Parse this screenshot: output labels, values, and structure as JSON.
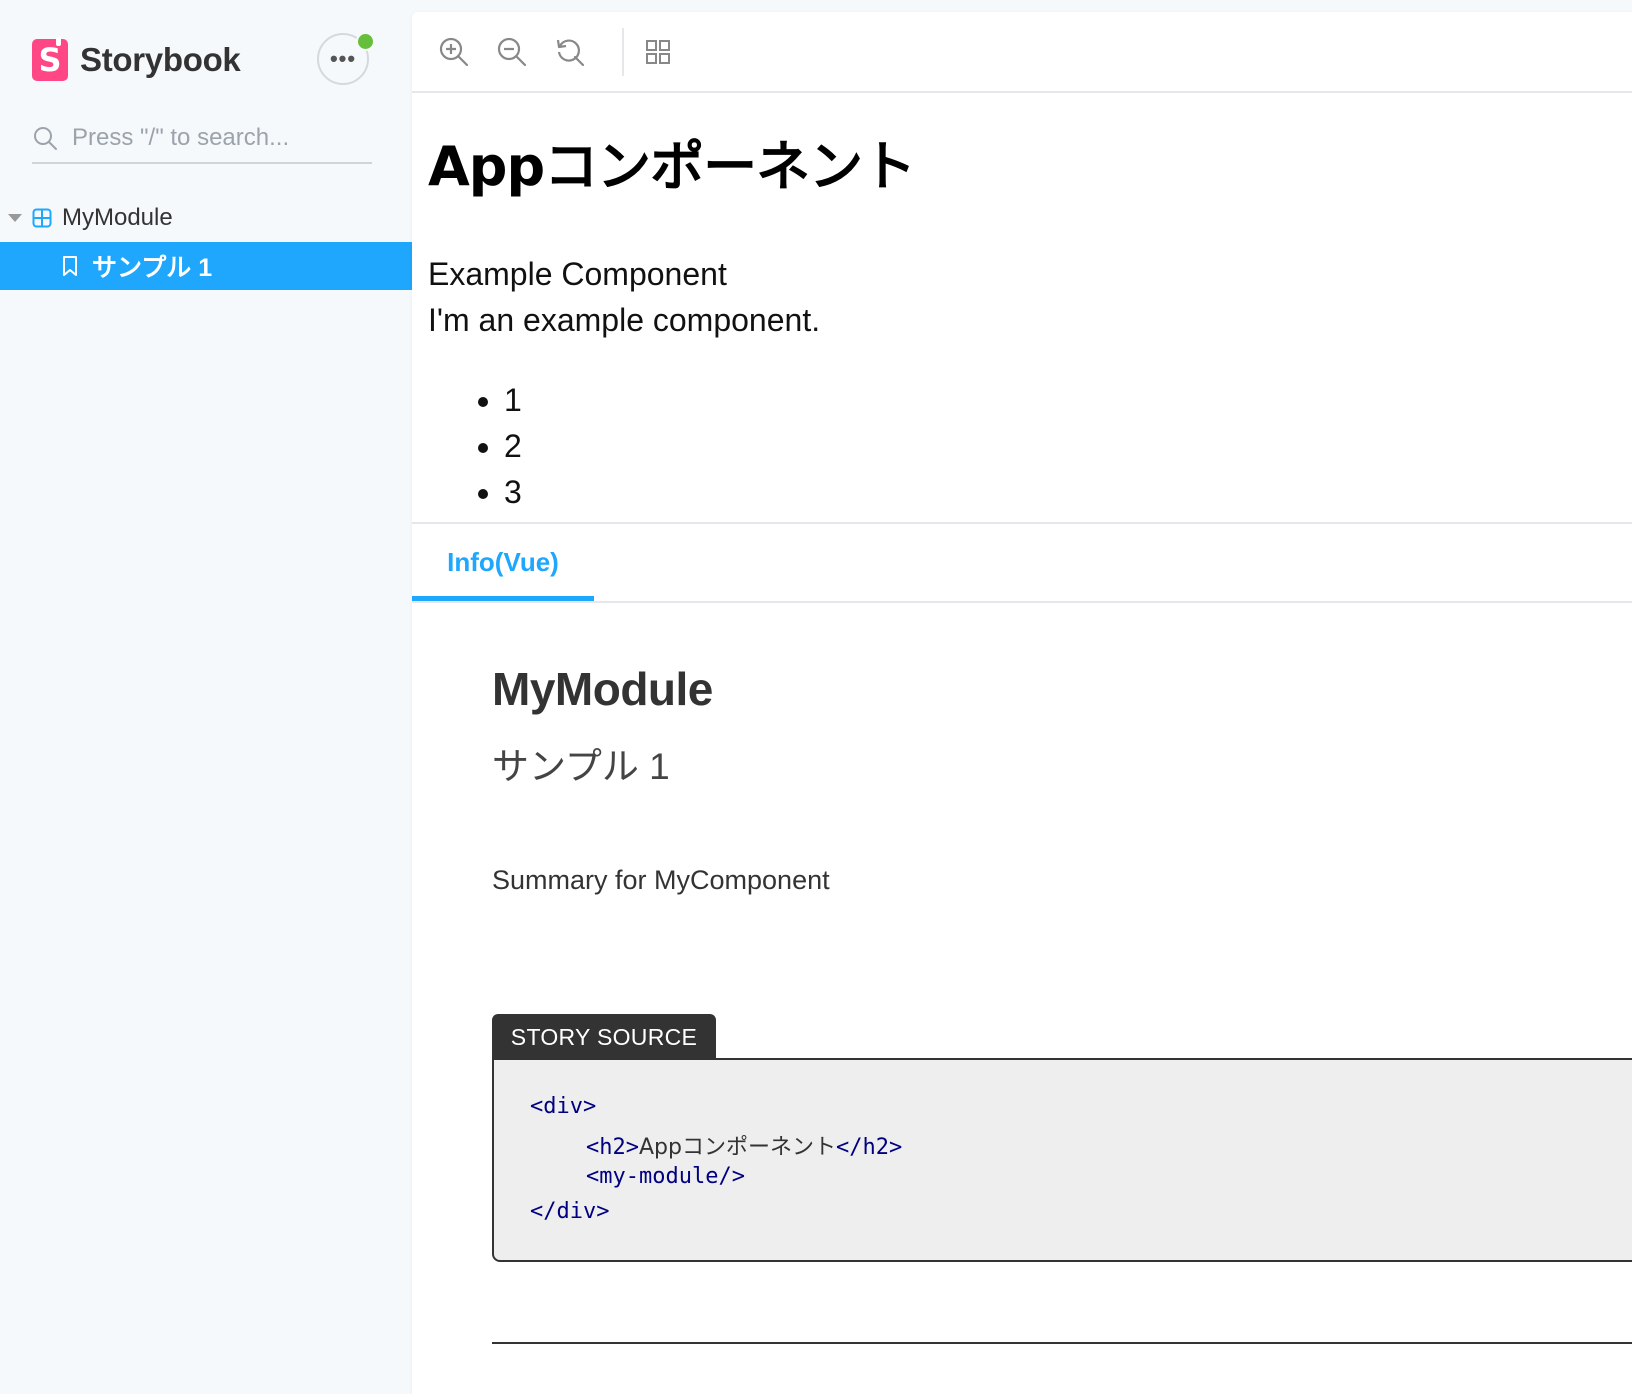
{
  "sidebar": {
    "brand_name": "Storybook",
    "search_placeholder": "Press \"/\" to search...",
    "tree": {
      "group_label": "MyModule",
      "story_label": "サンプル 1"
    }
  },
  "toolbar": {
    "icons": [
      "zoom-in-icon",
      "zoom-out-icon",
      "zoom-reset-icon",
      "grid-icon"
    ]
  },
  "preview": {
    "heading": "Appコンポーネント",
    "line1": "Example Component",
    "line2": "I'm an example component.",
    "list": [
      "1",
      "2",
      "3"
    ]
  },
  "addons": {
    "active_tab": "Info(Vue)"
  },
  "info": {
    "title": "MyModule",
    "subtitle": "サンプル 1",
    "summary": "Summary for MyComponent",
    "source_label": "STORY SOURCE",
    "code": {
      "open_div": "<div>",
      "h2_open": "<h2>",
      "h2_text": "Appコンポーネント",
      "h2_close": "</h2>",
      "module": "<my-module/>",
      "close_div": "</div>"
    }
  },
  "colors": {
    "accent": "#1ea7fd",
    "brand": "#ff4785",
    "status": "#66bf3c",
    "code_tag": "#000080"
  }
}
